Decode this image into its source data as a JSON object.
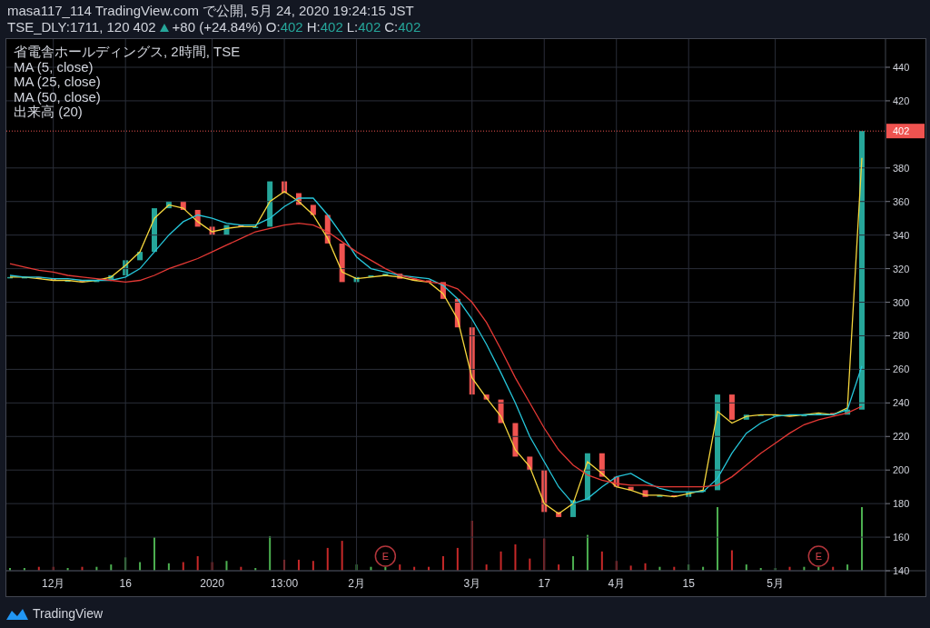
{
  "header": {
    "published": "masa117_114 TradingView.com で公開, 5月 24, 2020 19:24:15 JST",
    "symbol": "TSE_DLY:1711, 120",
    "last": "402",
    "change": "+80 (+24.84%)",
    "ohlc": [
      {
        "label": "O:",
        "value": "402"
      },
      {
        "label": "H:",
        "value": "402"
      },
      {
        "label": "L:",
        "value": "402"
      },
      {
        "label": "C:",
        "value": "402"
      }
    ]
  },
  "legend": {
    "title": "省電舎ホールディングス, 2時間, TSE",
    "volume": "出来高 (20)"
  },
  "events": [
    {
      "text": "E"
    },
    {
      "text": "E"
    }
  ],
  "chart_data": {
    "type": "line",
    "grid": true,
    "ylim": [
      140,
      440
    ],
    "ref_lines": [
      {
        "axis": "y",
        "value": 402,
        "label": "402",
        "color": "#ef5350"
      }
    ],
    "yticks": [
      140,
      160,
      180,
      200,
      220,
      240,
      260,
      280,
      300,
      320,
      340,
      360,
      380,
      420,
      440
    ],
    "categories": [
      null,
      null,
      null,
      "12月",
      null,
      null,
      null,
      null,
      "16",
      null,
      null,
      null,
      null,
      null,
      "2020",
      null,
      null,
      null,
      null,
      "13:00",
      null,
      null,
      null,
      null,
      "2月",
      null,
      null,
      null,
      null,
      null,
      null,
      null,
      "3月",
      null,
      null,
      null,
      null,
      "17",
      null,
      null,
      null,
      null,
      "4月",
      null,
      null,
      null,
      null,
      "15",
      null,
      null,
      null,
      null,
      null,
      "5月",
      null,
      null,
      null,
      null,
      null,
      null
    ],
    "series": [
      {
        "name": "MA (5, close)",
        "color": "#f5d63d",
        "values": [
          315,
          315,
          314,
          313,
          313,
          312,
          313,
          315,
          322,
          330,
          350,
          358,
          356,
          348,
          342,
          344,
          345,
          345,
          360,
          366,
          360,
          352,
          338,
          318,
          314,
          315,
          316,
          315,
          313,
          312,
          305,
          290,
          255,
          243,
          232,
          212,
          202,
          180,
          174,
          180,
          205,
          198,
          190,
          188,
          185,
          185,
          184,
          186,
          188,
          235,
          228,
          232,
          233,
          233,
          232,
          233,
          234,
          233,
          237,
          386
        ]
      },
      {
        "name": "MA (25, close)",
        "color": "#26c6da",
        "values": [
          316,
          315,
          315,
          314,
          314,
          313,
          313,
          313,
          315,
          320,
          330,
          340,
          348,
          352,
          350,
          347,
          346,
          346,
          350,
          357,
          362,
          362,
          352,
          340,
          327,
          320,
          318,
          316,
          315,
          314,
          310,
          302,
          290,
          275,
          258,
          240,
          220,
          205,
          190,
          180,
          183,
          190,
          196,
          198,
          193,
          189,
          187,
          187,
          187,
          195,
          210,
          222,
          228,
          232,
          233,
          233,
          233,
          233,
          236,
          262
        ]
      },
      {
        "name": "MA (50, close)",
        "color": "#e53935",
        "values": [
          323,
          321,
          319,
          318,
          316,
          315,
          314,
          313,
          312,
          313,
          316,
          320,
          323,
          326,
          330,
          334,
          338,
          342,
          344,
          346,
          347,
          346,
          342,
          336,
          330,
          325,
          320,
          316,
          314,
          312,
          311,
          308,
          300,
          288,
          272,
          255,
          240,
          225,
          212,
          203,
          197,
          194,
          192,
          191,
          191,
          190,
          190,
          190,
          190,
          191,
          196,
          203,
          210,
          216,
          222,
          227,
          230,
          232,
          234,
          238
        ]
      }
    ]
  },
  "footer": {
    "brand": "TradingView"
  }
}
